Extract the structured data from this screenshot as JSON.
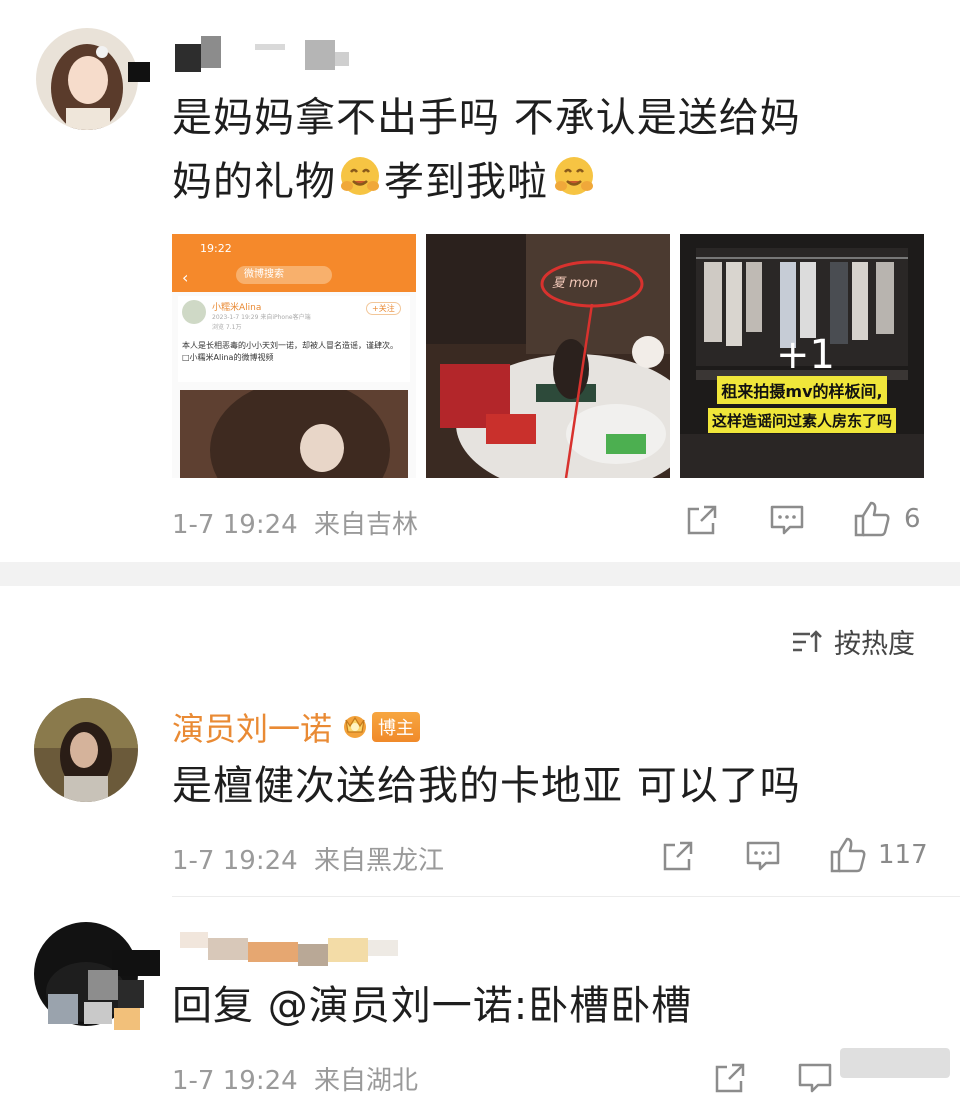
{
  "post": {
    "content_line1": "是妈妈拿不出手吗 不承认是送给妈",
    "content_line2_a": "妈的礼物",
    "content_line2_b": "孝到我啦",
    "images": {
      "img1": {
        "time": "19:22",
        "header": "微博搜索",
        "user": "小糯米Alina",
        "meta": "2023-1-7 19:29 来自iPhone客户端",
        "follow": "+关注",
        "views": "浏览 7.1万",
        "text": "本人是长相恶毒的小小天刘一诺，却被人冒名造谣，谨肆次。 □小糯米Alina的微博视频"
      },
      "img2": {
        "circle_text": "夏 mon"
      },
      "img3": {
        "plus": "+1",
        "caption_line1": "租来拍摄mv的样板间,",
        "caption_line2": "这样造谣问过素人房东了吗"
      }
    },
    "timestamp": "1-7 19:24",
    "location": "来自吉林",
    "like_count": "6"
  },
  "comments": {
    "sort_label": "按热度",
    "sort_icon": "sort-icon",
    "items": [
      {
        "username": "演员刘一诺",
        "badge": "博主",
        "content": "是檀健次送给我的卡地亚 可以了吗",
        "timestamp": "1-7 19:24",
        "location": "来自黑龙江",
        "like_count": "117"
      },
      {
        "content": "回复 @演员刘一诺:卧槽卧槽",
        "timestamp": "1-7 19:24",
        "location": "来自湖北"
      }
    ]
  },
  "colors": {
    "accent_orange": "#e98a34",
    "meta_gray": "#9a9a9a",
    "weibo_orange": "#f5892b"
  }
}
